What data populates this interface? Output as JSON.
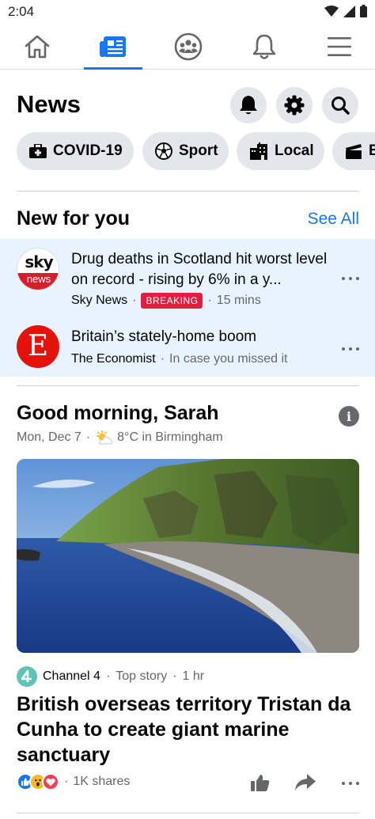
{
  "status_bar": {
    "time": "2:04",
    "icons": [
      "wifi-icon",
      "signal-icon",
      "battery-icon"
    ]
  },
  "nav": {
    "tabs": [
      {
        "name": "home",
        "icon": "home-icon"
      },
      {
        "name": "news",
        "icon": "news-icon",
        "active": true
      },
      {
        "name": "groups",
        "icon": "groups-icon"
      },
      {
        "name": "notifications",
        "icon": "bell-icon"
      },
      {
        "name": "menu",
        "icon": "hamburger-menu-icon"
      }
    ],
    "accent": "#1877f2"
  },
  "header": {
    "title": "News",
    "buttons": [
      "bell-icon",
      "gear-icon",
      "search-icon"
    ]
  },
  "chips": [
    {
      "label": "COVID-19",
      "icon": "medical-kit-icon"
    },
    {
      "label": "Sport",
      "icon": "football-icon"
    },
    {
      "label": "Local",
      "icon": "city-icon"
    },
    {
      "label": "E",
      "icon": "clapperboard-icon"
    }
  ],
  "new_for_you": {
    "title": "New for you",
    "see_all": "See All",
    "items": [
      {
        "logo": "sky-news-logo",
        "logo_text_top": "sky",
        "logo_text_bottom": "news",
        "headline": "Drug deaths in Scotland hit worst level on record - rising by 6% in a y...",
        "source": "Sky News",
        "badge": "BREAKING",
        "time": "15 mins"
      },
      {
        "logo": "the-economist-logo",
        "logo_text": "E",
        "headline": "Britain’s stately-home boom",
        "source": "The Economist",
        "extra": "In case you missed it"
      }
    ],
    "highlight_color": "#e7f3ff"
  },
  "briefing": {
    "greeting": "Good morning, Sarah",
    "date": "Mon, Dec 7",
    "weather": "8°C in Birmingham",
    "weather_icon": "partly-cloudy-icon"
  },
  "top_story": {
    "image": "coastal-cliff-photo",
    "source": "Channel 4",
    "label": "Top story",
    "time": "1 hr",
    "headline": "British overseas territory Tristan da Cunha to create giant marine sanctuary",
    "reactions": [
      "like-reaction",
      "wow-reaction",
      "love-reaction"
    ],
    "shares": "1K shares"
  },
  "separator": "·"
}
